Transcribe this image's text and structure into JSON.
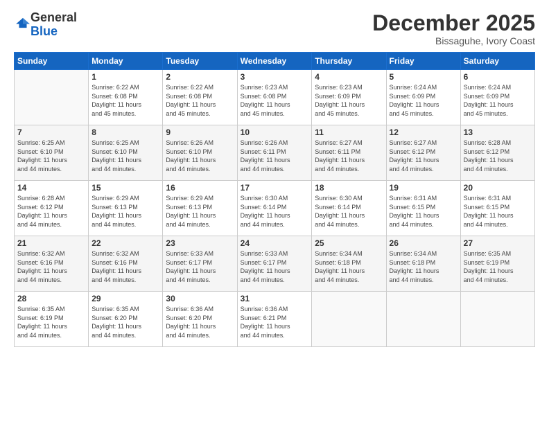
{
  "logo": {
    "general": "General",
    "blue": "Blue"
  },
  "header": {
    "month": "December 2025",
    "location": "Bissaguhe, Ivory Coast"
  },
  "weekdays": [
    "Sunday",
    "Monday",
    "Tuesday",
    "Wednesday",
    "Thursday",
    "Friday",
    "Saturday"
  ],
  "weeks": [
    [
      {
        "day": "",
        "info": ""
      },
      {
        "day": "1",
        "info": "Sunrise: 6:22 AM\nSunset: 6:08 PM\nDaylight: 11 hours\nand 45 minutes."
      },
      {
        "day": "2",
        "info": "Sunrise: 6:22 AM\nSunset: 6:08 PM\nDaylight: 11 hours\nand 45 minutes."
      },
      {
        "day": "3",
        "info": "Sunrise: 6:23 AM\nSunset: 6:08 PM\nDaylight: 11 hours\nand 45 minutes."
      },
      {
        "day": "4",
        "info": "Sunrise: 6:23 AM\nSunset: 6:09 PM\nDaylight: 11 hours\nand 45 minutes."
      },
      {
        "day": "5",
        "info": "Sunrise: 6:24 AM\nSunset: 6:09 PM\nDaylight: 11 hours\nand 45 minutes."
      },
      {
        "day": "6",
        "info": "Sunrise: 6:24 AM\nSunset: 6:09 PM\nDaylight: 11 hours\nand 45 minutes."
      }
    ],
    [
      {
        "day": "7",
        "info": "Sunrise: 6:25 AM\nSunset: 6:10 PM\nDaylight: 11 hours\nand 44 minutes."
      },
      {
        "day": "8",
        "info": "Sunrise: 6:25 AM\nSunset: 6:10 PM\nDaylight: 11 hours\nand 44 minutes."
      },
      {
        "day": "9",
        "info": "Sunrise: 6:26 AM\nSunset: 6:10 PM\nDaylight: 11 hours\nand 44 minutes."
      },
      {
        "day": "10",
        "info": "Sunrise: 6:26 AM\nSunset: 6:11 PM\nDaylight: 11 hours\nand 44 minutes."
      },
      {
        "day": "11",
        "info": "Sunrise: 6:27 AM\nSunset: 6:11 PM\nDaylight: 11 hours\nand 44 minutes."
      },
      {
        "day": "12",
        "info": "Sunrise: 6:27 AM\nSunset: 6:12 PM\nDaylight: 11 hours\nand 44 minutes."
      },
      {
        "day": "13",
        "info": "Sunrise: 6:28 AM\nSunset: 6:12 PM\nDaylight: 11 hours\nand 44 minutes."
      }
    ],
    [
      {
        "day": "14",
        "info": "Sunrise: 6:28 AM\nSunset: 6:12 PM\nDaylight: 11 hours\nand 44 minutes."
      },
      {
        "day": "15",
        "info": "Sunrise: 6:29 AM\nSunset: 6:13 PM\nDaylight: 11 hours\nand 44 minutes."
      },
      {
        "day": "16",
        "info": "Sunrise: 6:29 AM\nSunset: 6:13 PM\nDaylight: 11 hours\nand 44 minutes."
      },
      {
        "day": "17",
        "info": "Sunrise: 6:30 AM\nSunset: 6:14 PM\nDaylight: 11 hours\nand 44 minutes."
      },
      {
        "day": "18",
        "info": "Sunrise: 6:30 AM\nSunset: 6:14 PM\nDaylight: 11 hours\nand 44 minutes."
      },
      {
        "day": "19",
        "info": "Sunrise: 6:31 AM\nSunset: 6:15 PM\nDaylight: 11 hours\nand 44 minutes."
      },
      {
        "day": "20",
        "info": "Sunrise: 6:31 AM\nSunset: 6:15 PM\nDaylight: 11 hours\nand 44 minutes."
      }
    ],
    [
      {
        "day": "21",
        "info": "Sunrise: 6:32 AM\nSunset: 6:16 PM\nDaylight: 11 hours\nand 44 minutes."
      },
      {
        "day": "22",
        "info": "Sunrise: 6:32 AM\nSunset: 6:16 PM\nDaylight: 11 hours\nand 44 minutes."
      },
      {
        "day": "23",
        "info": "Sunrise: 6:33 AM\nSunset: 6:17 PM\nDaylight: 11 hours\nand 44 minutes."
      },
      {
        "day": "24",
        "info": "Sunrise: 6:33 AM\nSunset: 6:17 PM\nDaylight: 11 hours\nand 44 minutes."
      },
      {
        "day": "25",
        "info": "Sunrise: 6:34 AM\nSunset: 6:18 PM\nDaylight: 11 hours\nand 44 minutes."
      },
      {
        "day": "26",
        "info": "Sunrise: 6:34 AM\nSunset: 6:18 PM\nDaylight: 11 hours\nand 44 minutes."
      },
      {
        "day": "27",
        "info": "Sunrise: 6:35 AM\nSunset: 6:19 PM\nDaylight: 11 hours\nand 44 minutes."
      }
    ],
    [
      {
        "day": "28",
        "info": "Sunrise: 6:35 AM\nSunset: 6:19 PM\nDaylight: 11 hours\nand 44 minutes."
      },
      {
        "day": "29",
        "info": "Sunrise: 6:35 AM\nSunset: 6:20 PM\nDaylight: 11 hours\nand 44 minutes."
      },
      {
        "day": "30",
        "info": "Sunrise: 6:36 AM\nSunset: 6:20 PM\nDaylight: 11 hours\nand 44 minutes."
      },
      {
        "day": "31",
        "info": "Sunrise: 6:36 AM\nSunset: 6:21 PM\nDaylight: 11 hours\nand 44 minutes."
      },
      {
        "day": "",
        "info": ""
      },
      {
        "day": "",
        "info": ""
      },
      {
        "day": "",
        "info": ""
      }
    ]
  ]
}
